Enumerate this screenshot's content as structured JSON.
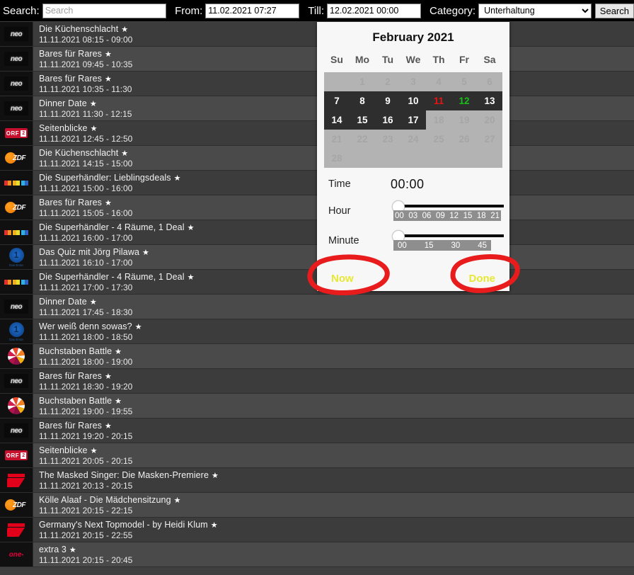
{
  "toolbar": {
    "search_label": "Search:",
    "search_placeholder": "Search",
    "search_value": "",
    "from_label": "From:",
    "from_value": "11.02.2021 07:27",
    "till_label": "Till:",
    "till_value": "12.02.2021 00:00",
    "category_label": "Category:",
    "category_selected": "Unterhaltung",
    "category_options": [
      "Unterhaltung"
    ],
    "search_button": "Search"
  },
  "picker": {
    "month_title": "February 2021",
    "weekday_headers": [
      "Su",
      "Mo",
      "Tu",
      "We",
      "Th",
      "Fr",
      "Sa"
    ],
    "weeks": [
      [
        {
          "d": "1",
          "state": "out"
        },
        {
          "d": "2",
          "state": "out"
        },
        {
          "d": "3",
          "state": "out"
        },
        {
          "d": "4",
          "state": "out"
        },
        {
          "d": "5",
          "state": "out"
        },
        {
          "d": "6",
          "state": "out"
        },
        {
          "d": "",
          "state": "blank"
        }
      ],
      [
        {
          "d": "7",
          "state": "sel"
        },
        {
          "d": "8",
          "state": "sel"
        },
        {
          "d": "9",
          "state": "sel"
        },
        {
          "d": "10",
          "state": "sel"
        },
        {
          "d": "11",
          "state": "today"
        },
        {
          "d": "12",
          "state": "chosen"
        },
        {
          "d": "13",
          "state": "sel"
        }
      ],
      [
        {
          "d": "14",
          "state": "sel"
        },
        {
          "d": "15",
          "state": "sel"
        },
        {
          "d": "16",
          "state": "sel"
        },
        {
          "d": "17",
          "state": "sel"
        },
        {
          "d": "18",
          "state": "out"
        },
        {
          "d": "19",
          "state": "out"
        },
        {
          "d": "20",
          "state": "out"
        }
      ],
      [
        {
          "d": "21",
          "state": "out"
        },
        {
          "d": "22",
          "state": "out"
        },
        {
          "d": "23",
          "state": "out"
        },
        {
          "d": "24",
          "state": "out"
        },
        {
          "d": "25",
          "state": "out"
        },
        {
          "d": "26",
          "state": "out"
        },
        {
          "d": "27",
          "state": "out"
        }
      ],
      [
        {
          "d": "28",
          "state": "out"
        },
        {
          "d": "",
          "state": "blank"
        },
        {
          "d": "",
          "state": "blank"
        },
        {
          "d": "",
          "state": "blank"
        },
        {
          "d": "",
          "state": "blank"
        },
        {
          "d": "",
          "state": "blank"
        },
        {
          "d": "",
          "state": "blank"
        }
      ]
    ],
    "note_first_week_shifted": "1 falls on Monday column",
    "time_label": "Time",
    "time_value": "00:00",
    "hour_label": "Hour",
    "hour_ticks": [
      "00",
      "03",
      "06",
      "09",
      "12",
      "15",
      "18",
      "21"
    ],
    "minute_label": "Minute",
    "minute_ticks": [
      "00",
      "15",
      "30",
      "45"
    ],
    "now_button": "Now",
    "done_button": "Done",
    "accent_yellow": "#e8e832",
    "annotation_color": "#e81c1c",
    "today_color": "#e81313",
    "chosen_color": "#18c018"
  },
  "programs": [
    {
      "channel": "zdfneo",
      "logo": "neo",
      "title": "Die Küchenschlacht",
      "starred": true,
      "time": "11.11.2021 08:15 - 09:00"
    },
    {
      "channel": "zdfneo",
      "logo": "neo",
      "title": "Bares für Rares",
      "starred": true,
      "time": "11.11.2021 09:45 - 10:35"
    },
    {
      "channel": "zdfneo",
      "logo": "neo",
      "title": "Bares für Rares",
      "starred": true,
      "time": "11.11.2021 10:35 - 11:30"
    },
    {
      "channel": "zdfneo",
      "logo": "neo",
      "title": "Dinner Date",
      "starred": true,
      "time": "11.11.2021 11:30 - 12:15"
    },
    {
      "channel": "ORF 2",
      "logo": "orf2",
      "title": "Seitenblicke",
      "starred": true,
      "time": "11.11.2021 12:45 - 12:50"
    },
    {
      "channel": "ZDF",
      "logo": "zdf",
      "title": "Die Küchenschlacht",
      "starred": true,
      "time": "11.11.2021 14:15 - 15:00"
    },
    {
      "channel": "RTL",
      "logo": "rtl",
      "title": "Die Superhändler: Lieblingsdeals",
      "starred": true,
      "time": "11.11.2021 15:00 - 16:00"
    },
    {
      "channel": "ZDF",
      "logo": "zdf",
      "title": "Bares für Rares",
      "starred": true,
      "time": "11.11.2021 15:05 - 16:00"
    },
    {
      "channel": "RTL",
      "logo": "rtl",
      "title": "Die Superhändler - 4 Räume, 1 Deal",
      "starred": true,
      "time": "11.11.2021 16:00 - 17:00"
    },
    {
      "channel": "Das Erste",
      "logo": "ard",
      "title": "Das Quiz mit Jörg Pilawa",
      "starred": true,
      "time": "11.11.2021 16:10 - 17:00"
    },
    {
      "channel": "RTL",
      "logo": "rtl",
      "title": "Die Superhändler - 4 Räume, 1 Deal",
      "starred": true,
      "time": "11.11.2021 17:00 - 17:30"
    },
    {
      "channel": "zdfneo",
      "logo": "neo",
      "title": "Dinner Date",
      "starred": true,
      "time": "11.11.2021 17:45 - 18:30"
    },
    {
      "channel": "Das Erste",
      "logo": "ard",
      "title": "Wer weiß denn sowas?",
      "starred": true,
      "time": "11.11.2021 18:00 - 18:50"
    },
    {
      "channel": "Sat.1",
      "logo": "sat1",
      "title": "Buchstaben Battle",
      "starred": true,
      "time": "11.11.2021 18:00 - 19:00"
    },
    {
      "channel": "zdfneo",
      "logo": "neo",
      "title": "Bares für Rares",
      "starred": true,
      "time": "11.11.2021 18:30 - 19:20"
    },
    {
      "channel": "Sat.1",
      "logo": "sat1",
      "title": "Buchstaben Battle",
      "starred": true,
      "time": "11.11.2021 19:00 - 19:55"
    },
    {
      "channel": "zdfneo",
      "logo": "neo",
      "title": "Bares für Rares",
      "starred": true,
      "time": "11.11.2021 19:20 - 20:15"
    },
    {
      "channel": "ORF 2",
      "logo": "orf2",
      "title": "Seitenblicke",
      "starred": true,
      "time": "11.11.2021 20:05 - 20:15"
    },
    {
      "channel": "ProSieben",
      "logo": "pro7",
      "title": "The Masked Singer: Die Masken-Premiere",
      "starred": true,
      "time": "11.11.2021 20:13 - 20:15"
    },
    {
      "channel": "ZDF",
      "logo": "zdf",
      "title": "Kölle Alaaf - Die Mädchensitzung",
      "starred": true,
      "time": "11.11.2021 20:15 - 22:15"
    },
    {
      "channel": "ProSieben",
      "logo": "pro7",
      "title": "Germany's Next Topmodel - by Heidi Klum",
      "starred": true,
      "time": "11.11.2021 20:15 - 22:55"
    },
    {
      "channel": "ONE",
      "logo": "one",
      "title": "extra 3",
      "starred": true,
      "time": "11.11.2021 20:15 - 20:45"
    }
  ]
}
